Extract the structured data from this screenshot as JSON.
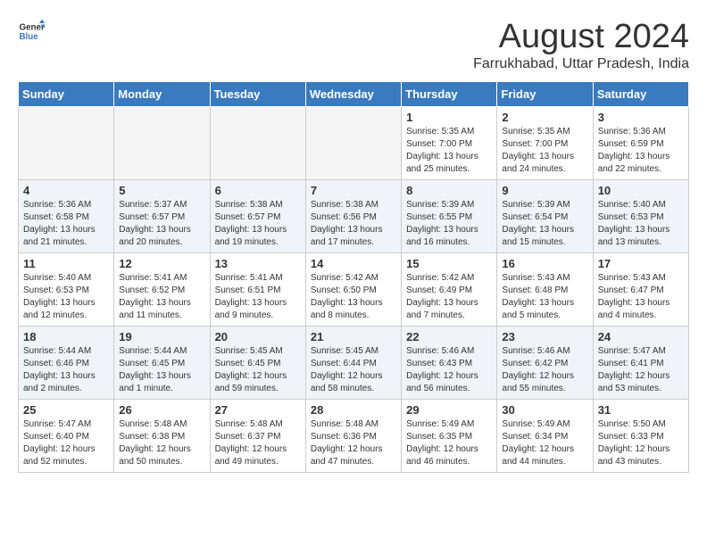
{
  "header": {
    "logo_general": "General",
    "logo_blue": "Blue",
    "month_year": "August 2024",
    "location": "Farrukhabad, Uttar Pradesh, India"
  },
  "weekdays": [
    "Sunday",
    "Monday",
    "Tuesday",
    "Wednesday",
    "Thursday",
    "Friday",
    "Saturday"
  ],
  "weeks": [
    [
      {
        "day": "",
        "info": ""
      },
      {
        "day": "",
        "info": ""
      },
      {
        "day": "",
        "info": ""
      },
      {
        "day": "",
        "info": ""
      },
      {
        "day": "1",
        "info": "Sunrise: 5:35 AM\nSunset: 7:00 PM\nDaylight: 13 hours\nand 25 minutes."
      },
      {
        "day": "2",
        "info": "Sunrise: 5:35 AM\nSunset: 7:00 PM\nDaylight: 13 hours\nand 24 minutes."
      },
      {
        "day": "3",
        "info": "Sunrise: 5:36 AM\nSunset: 6:59 PM\nDaylight: 13 hours\nand 22 minutes."
      }
    ],
    [
      {
        "day": "4",
        "info": "Sunrise: 5:36 AM\nSunset: 6:58 PM\nDaylight: 13 hours\nand 21 minutes."
      },
      {
        "day": "5",
        "info": "Sunrise: 5:37 AM\nSunset: 6:57 PM\nDaylight: 13 hours\nand 20 minutes."
      },
      {
        "day": "6",
        "info": "Sunrise: 5:38 AM\nSunset: 6:57 PM\nDaylight: 13 hours\nand 19 minutes."
      },
      {
        "day": "7",
        "info": "Sunrise: 5:38 AM\nSunset: 6:56 PM\nDaylight: 13 hours\nand 17 minutes."
      },
      {
        "day": "8",
        "info": "Sunrise: 5:39 AM\nSunset: 6:55 PM\nDaylight: 13 hours\nand 16 minutes."
      },
      {
        "day": "9",
        "info": "Sunrise: 5:39 AM\nSunset: 6:54 PM\nDaylight: 13 hours\nand 15 minutes."
      },
      {
        "day": "10",
        "info": "Sunrise: 5:40 AM\nSunset: 6:53 PM\nDaylight: 13 hours\nand 13 minutes."
      }
    ],
    [
      {
        "day": "11",
        "info": "Sunrise: 5:40 AM\nSunset: 6:53 PM\nDaylight: 13 hours\nand 12 minutes."
      },
      {
        "day": "12",
        "info": "Sunrise: 5:41 AM\nSunset: 6:52 PM\nDaylight: 13 hours\nand 11 minutes."
      },
      {
        "day": "13",
        "info": "Sunrise: 5:41 AM\nSunset: 6:51 PM\nDaylight: 13 hours\nand 9 minutes."
      },
      {
        "day": "14",
        "info": "Sunrise: 5:42 AM\nSunset: 6:50 PM\nDaylight: 13 hours\nand 8 minutes."
      },
      {
        "day": "15",
        "info": "Sunrise: 5:42 AM\nSunset: 6:49 PM\nDaylight: 13 hours\nand 7 minutes."
      },
      {
        "day": "16",
        "info": "Sunrise: 5:43 AM\nSunset: 6:48 PM\nDaylight: 13 hours\nand 5 minutes."
      },
      {
        "day": "17",
        "info": "Sunrise: 5:43 AM\nSunset: 6:47 PM\nDaylight: 13 hours\nand 4 minutes."
      }
    ],
    [
      {
        "day": "18",
        "info": "Sunrise: 5:44 AM\nSunset: 6:46 PM\nDaylight: 13 hours\nand 2 minutes."
      },
      {
        "day": "19",
        "info": "Sunrise: 5:44 AM\nSunset: 6:45 PM\nDaylight: 13 hours\nand 1 minute."
      },
      {
        "day": "20",
        "info": "Sunrise: 5:45 AM\nSunset: 6:45 PM\nDaylight: 12 hours\nand 59 minutes."
      },
      {
        "day": "21",
        "info": "Sunrise: 5:45 AM\nSunset: 6:44 PM\nDaylight: 12 hours\nand 58 minutes."
      },
      {
        "day": "22",
        "info": "Sunrise: 5:46 AM\nSunset: 6:43 PM\nDaylight: 12 hours\nand 56 minutes."
      },
      {
        "day": "23",
        "info": "Sunrise: 5:46 AM\nSunset: 6:42 PM\nDaylight: 12 hours\nand 55 minutes."
      },
      {
        "day": "24",
        "info": "Sunrise: 5:47 AM\nSunset: 6:41 PM\nDaylight: 12 hours\nand 53 minutes."
      }
    ],
    [
      {
        "day": "25",
        "info": "Sunrise: 5:47 AM\nSunset: 6:40 PM\nDaylight: 12 hours\nand 52 minutes."
      },
      {
        "day": "26",
        "info": "Sunrise: 5:48 AM\nSunset: 6:38 PM\nDaylight: 12 hours\nand 50 minutes."
      },
      {
        "day": "27",
        "info": "Sunrise: 5:48 AM\nSunset: 6:37 PM\nDaylight: 12 hours\nand 49 minutes."
      },
      {
        "day": "28",
        "info": "Sunrise: 5:48 AM\nSunset: 6:36 PM\nDaylight: 12 hours\nand 47 minutes."
      },
      {
        "day": "29",
        "info": "Sunrise: 5:49 AM\nSunset: 6:35 PM\nDaylight: 12 hours\nand 46 minutes."
      },
      {
        "day": "30",
        "info": "Sunrise: 5:49 AM\nSunset: 6:34 PM\nDaylight: 12 hours\nand 44 minutes."
      },
      {
        "day": "31",
        "info": "Sunrise: 5:50 AM\nSunset: 6:33 PM\nDaylight: 12 hours\nand 43 minutes."
      }
    ]
  ]
}
